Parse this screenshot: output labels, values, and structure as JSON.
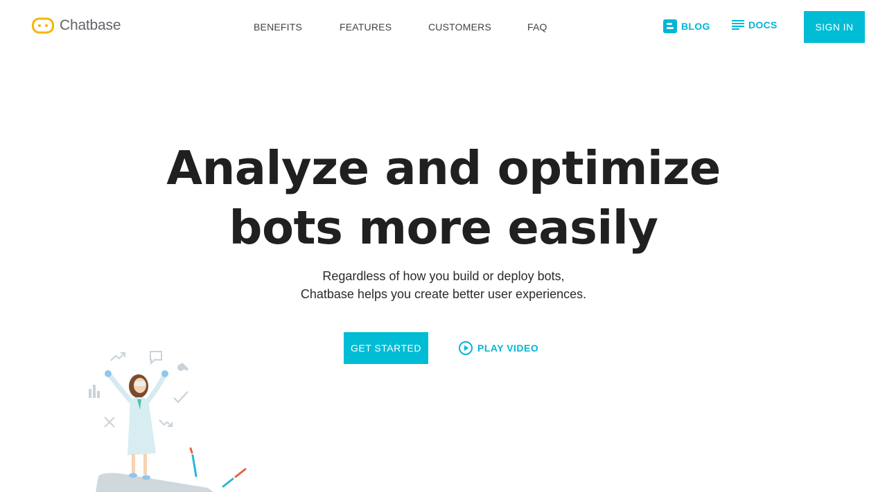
{
  "brand": {
    "name": "Chatbase",
    "logo_icon": "chat-bubble-logo-icon",
    "logo_color": "#f7b500"
  },
  "nav": {
    "items": [
      {
        "label": "BENEFITS"
      },
      {
        "label": "FEATURES"
      },
      {
        "label": "CUSTOMERS"
      },
      {
        "label": "FAQ"
      }
    ]
  },
  "links": {
    "blog": {
      "label": "BLOG",
      "icon": "blogger-icon"
    },
    "docs": {
      "label": "DOCS",
      "icon": "document-lines-icon"
    }
  },
  "signin": {
    "label": "SIGN IN"
  },
  "hero": {
    "title_line1": "Analyze and optimize",
    "title_line2": "bots more easily",
    "subtitle_line1": "Regardless of how you build or deploy bots,",
    "subtitle_line2": "Chatbase helps you create better user experiences."
  },
  "cta": {
    "get_started": "GET STARTED",
    "play_video": "PLAY VIDEO",
    "play_icon": "play-circle-icon"
  },
  "colors": {
    "accent": "#00bcd4",
    "text": "#212121",
    "muted_icons": "#cfd8dc"
  }
}
